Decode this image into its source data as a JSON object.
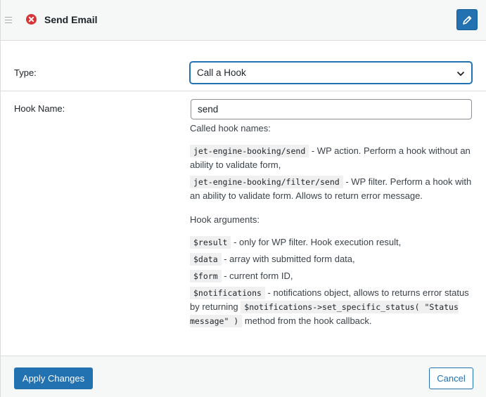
{
  "header": {
    "title": "Send Email",
    "status_icon": "error-icon",
    "edit_icon": "pencil-icon"
  },
  "type_row": {
    "label": "Type:",
    "selected": "Call a Hook"
  },
  "hook_row": {
    "label": "Hook Name:",
    "value": "send"
  },
  "help": {
    "intro": "Called hook names:",
    "hooks": [
      {
        "code": "jet-engine-booking/send",
        "text": " - WP action. Perform a hook without an ability to validate form,"
      },
      {
        "code": "jet-engine-booking/filter/send",
        "text": " - WP filter. Perform a hook with an ability to validate form. Allows to return error message."
      }
    ],
    "args_title": "Hook arguments:",
    "args": [
      {
        "code": "$result",
        "text": " - only for WP filter. Hook execution result,"
      },
      {
        "code": "$data",
        "text": " - array with submitted form data,"
      },
      {
        "code": "$form",
        "text": " - current form ID,"
      }
    ],
    "notif_code": "$notifications",
    "notif_text": " - notifications object, allows to returns error status by returning ",
    "notif_code2": "$notifications->set_specific_status( \"Status message\" )",
    "notif_tail": " method from the hook callback."
  },
  "footer": {
    "apply_label": "Apply Changes",
    "cancel_label": "Cancel"
  },
  "colors": {
    "primary": "#2271b1",
    "error": "#d63638",
    "header_bg": "#f6f7f7"
  }
}
